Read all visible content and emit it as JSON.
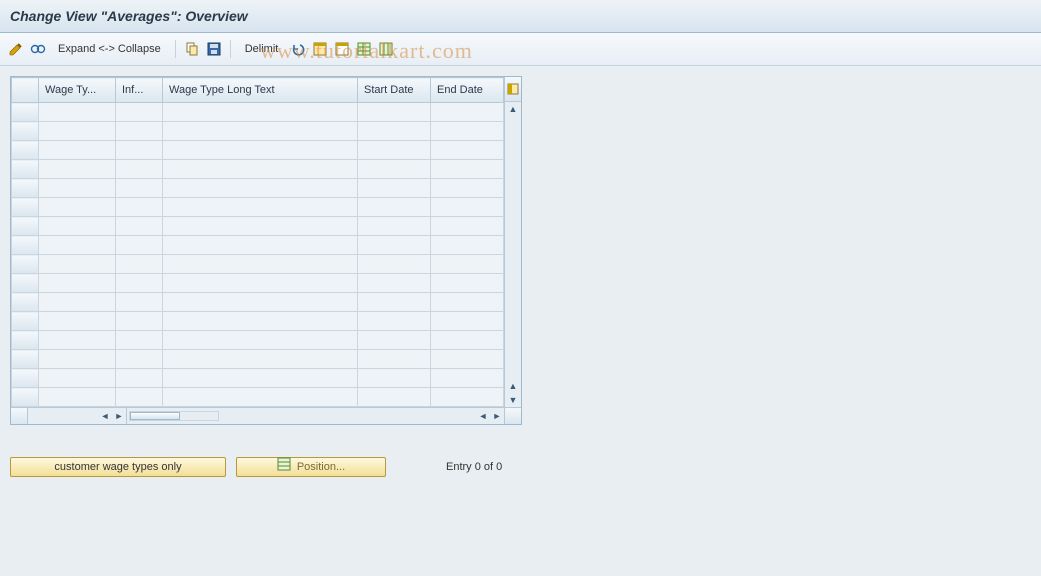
{
  "title": "Change View \"Averages\": Overview",
  "toolbar": {
    "expand_label": "Expand <-> Collapse",
    "delimit_label": "Delimit",
    "icons": {
      "change": "change-icon",
      "glasses": "display-icon",
      "copy": "copy-icon",
      "save": "save-icon",
      "undo": "undo-icon",
      "select_all": "select-all-icon",
      "deselect_all": "deselect-all-icon",
      "table_settings": "table-settings-icon",
      "config": "config-icon"
    }
  },
  "watermark": "www.tutorialkart.com",
  "table": {
    "columns": [
      {
        "key": "wage_type",
        "label": "Wage Ty..."
      },
      {
        "key": "inf",
        "label": "Inf..."
      },
      {
        "key": "long_text",
        "label": "Wage Type Long Text"
      },
      {
        "key": "start_date",
        "label": "Start Date"
      },
      {
        "key": "end_date",
        "label": "End Date"
      }
    ],
    "rows": [],
    "visible_row_count": 16
  },
  "footer": {
    "customer_btn": "customer wage types only",
    "position_btn": "Position...",
    "entry_text": "Entry 0 of 0"
  }
}
